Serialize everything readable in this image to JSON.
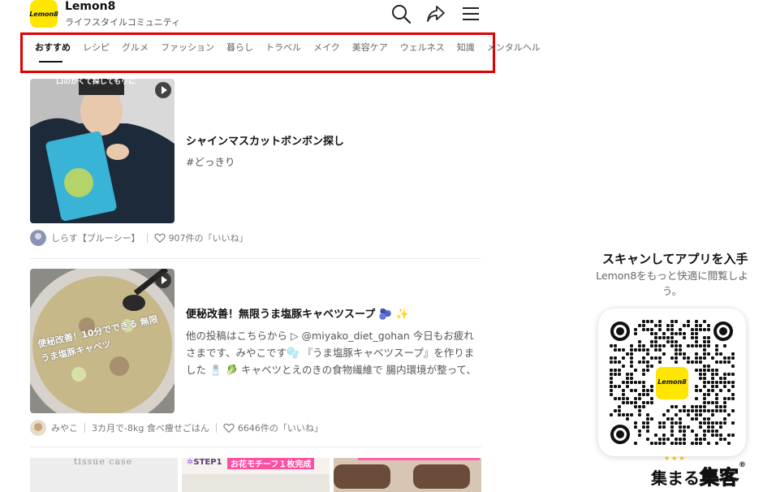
{
  "header": {
    "app_name": "Lemon8",
    "app_subtitle": "ライフスタイルコミュニティ",
    "logo_text": "Lemon8"
  },
  "tabs": [
    "おすすめ",
    "レシピ",
    "グルメ",
    "ファッション",
    "暮らし",
    "トラベル",
    "メイク",
    "美容ケア",
    "ウェルネス",
    "知識",
    "メンタルヘル"
  ],
  "active_tab": 0,
  "posts": [
    {
      "thumb_caption": "口のかくて探してもりに",
      "title": "シャインマスカットボンボン探し",
      "desc": "#どっきり",
      "author": "しらす【ブルーシー】",
      "likes": "907件の「いいね」"
    },
    {
      "thumb_caption": "便秘改善！10分でできる 無限うま塩豚キャベツ",
      "title": "便秘改善！無限うま塩豚キャベツスープ 🫐 ✨",
      "desc": "他の投稿はこちらから ▷ @miyako_diet_gohan 今日もお疲れさまです、みやこです🫧 『うま塩豚キャベツスープ』を作りました 🧂 🥬 キャベツとえのきの食物繊維で 腸内環境が整って、腸がスッ...",
      "author": "みやこ",
      "author_extra": "3カ月で-8kg 食べ痩せごはん",
      "likes": "6646件の「いいね」"
    }
  ],
  "bottom_thumbs": {
    "left_caption": "tissue case",
    "mid_tag": "STEP1",
    "mid_caption": "お花モチーフ１枚完成"
  },
  "side_panel": {
    "title": "スキャンしてアプリを入手",
    "subtitle": "Lemon8をもっと快適に閲覧しよう。",
    "qr_logo_text": "Lemon8"
  },
  "watermark": {
    "prefix": "集まる",
    "main": "集客",
    "mark": "®"
  },
  "colors": {
    "brand_yellow": "#ffe600",
    "highlight_red": "#e00000",
    "watermark_pink": "#ff3fa6"
  }
}
